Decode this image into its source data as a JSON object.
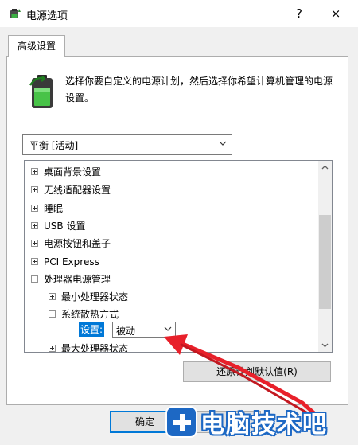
{
  "window": {
    "title": "电源选项",
    "help": "?",
    "close": "×"
  },
  "tab": {
    "label": "高级设置"
  },
  "description": "选择你要自定义的电源计划，然后选择你希望计算机管理的电源设置。",
  "plan_select": {
    "value": "平衡 [活动]"
  },
  "tree": {
    "items": [
      {
        "label": "桌面背景设置",
        "expanded": false
      },
      {
        "label": "无线适配器设置",
        "expanded": false
      },
      {
        "label": "睡眠",
        "expanded": false
      },
      {
        "label": "USB 设置",
        "expanded": false
      },
      {
        "label": "电源按钮和盖子",
        "expanded": false
      },
      {
        "label": "PCI Express",
        "expanded": false
      },
      {
        "label": "处理器电源管理",
        "expanded": true
      },
      {
        "label": "最小处理器状态",
        "expanded": false
      },
      {
        "label": "系统散热方式",
        "expanded": true
      },
      {
        "label": "最大处理器状态",
        "expanded": false
      }
    ],
    "setting": {
      "label": "设置:",
      "value": "被动"
    }
  },
  "buttons": {
    "restore": "还原计划默认值(R)",
    "ok": "确定"
  },
  "watermark": {
    "text": "电脑技术吧"
  },
  "colors": {
    "selection": "#0078d7",
    "arrow": "#e8202a",
    "watermark": "#1d68c4"
  }
}
